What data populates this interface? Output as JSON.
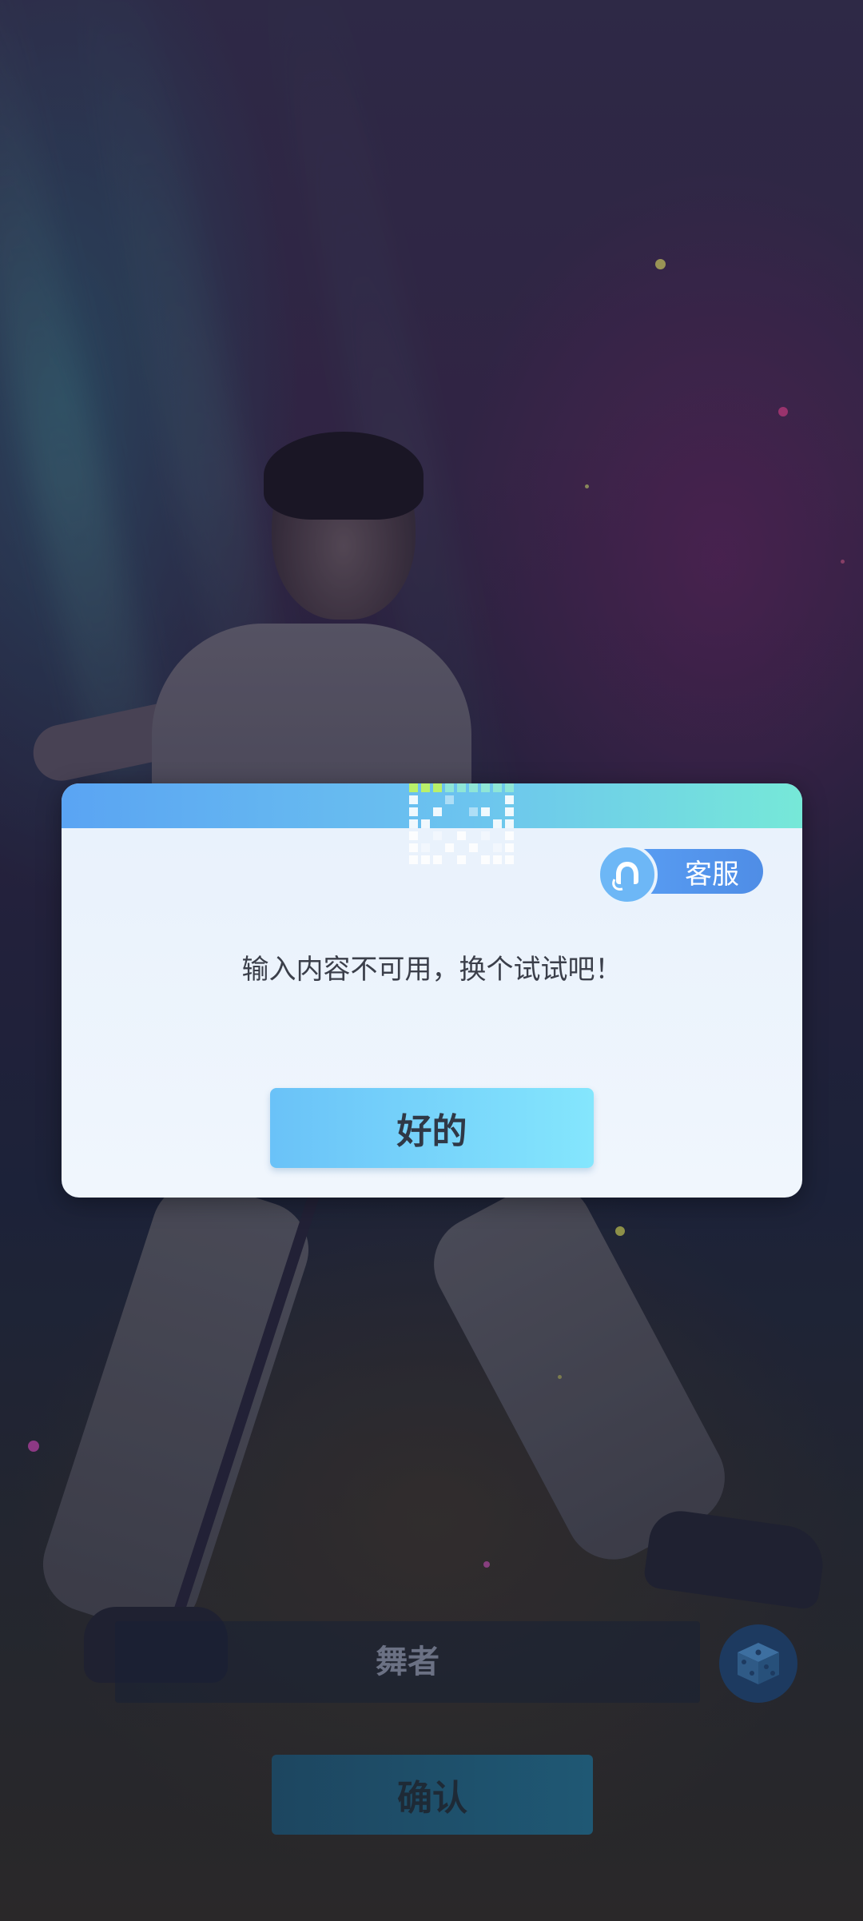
{
  "dialog": {
    "service_label": "客服",
    "message": "输入内容不可用，换个试试吧！",
    "ok_label": "好的"
  },
  "form": {
    "name_placeholder": "舞者",
    "confirm_label": "确认"
  },
  "colors": {
    "header_gradient_start": "#5aa4f3",
    "header_gradient_end": "#76e8d8",
    "ok_gradient_start": "#6ac2f8",
    "ok_gradient_end": "#84e6fd",
    "service_button": "#4f8de6"
  },
  "icons": {
    "service": "headset-icon",
    "dice": "dice-icon",
    "decoration": "pixel-grid-icon"
  }
}
